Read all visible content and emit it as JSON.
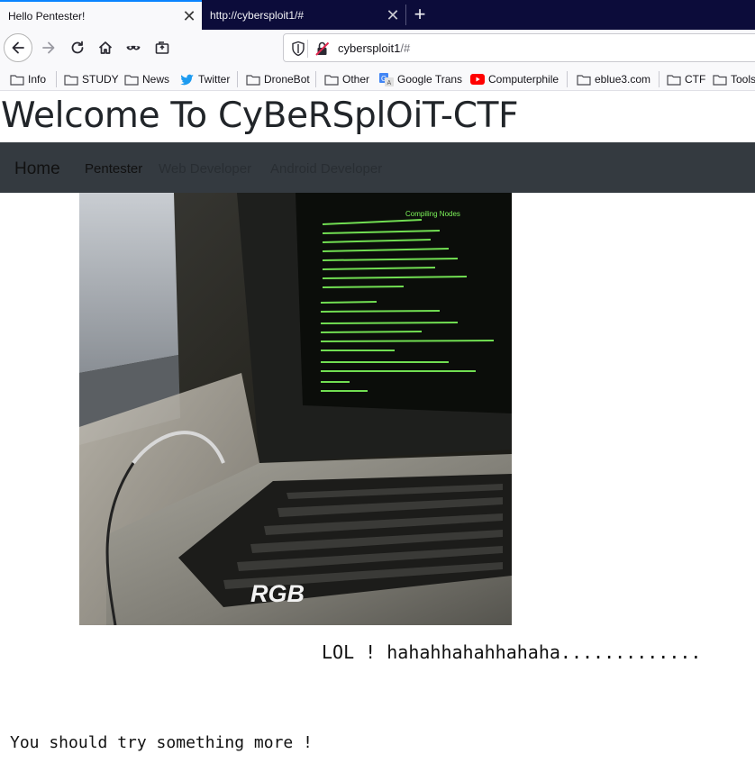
{
  "browser": {
    "tabs": [
      {
        "title": "Hello Pentester!",
        "active": true
      },
      {
        "title": "http://cybersploit1/#",
        "active": false
      }
    ],
    "new_tab_icon": "plus-icon",
    "url_host": "cybersploit1",
    "url_rest": "/#"
  },
  "bookmarks": [
    {
      "label": "Info",
      "icon": "folder-icon"
    },
    {
      "label": "STUDY",
      "icon": "folder-icon"
    },
    {
      "label": "News",
      "icon": "folder-icon"
    },
    {
      "label": "Twitter",
      "icon": "twitter-icon"
    },
    {
      "label": "DroneBot",
      "icon": "folder-icon"
    },
    {
      "label": "Other",
      "icon": "folder-icon"
    },
    {
      "label": "Google Trans",
      "icon": "google-translate-icon"
    },
    {
      "label": "Computerphile",
      "icon": "youtube-icon"
    },
    {
      "label": "eblue3.com",
      "icon": "folder-icon"
    },
    {
      "label": "CTF",
      "icon": "folder-icon"
    },
    {
      "label": "Tools",
      "icon": "folder-icon"
    }
  ],
  "page": {
    "title": "Welcome To CyBeRSplOiT-CTF",
    "nav": {
      "brand": "Home",
      "links": [
        "Pentester",
        "Web Developer",
        "Android Developer"
      ]
    },
    "image": {
      "watermark": "RGB",
      "screen_heading": "Compiling Nodes"
    },
    "lol_text": "LOL ! hahahhahahhahaha.............",
    "try_text": "You should try something more !"
  },
  "colors": {
    "tabstrip": "#0c0c3a",
    "navbar": "#343a40",
    "accent": "#0a84ff",
    "screen_code": "#7df55a"
  }
}
